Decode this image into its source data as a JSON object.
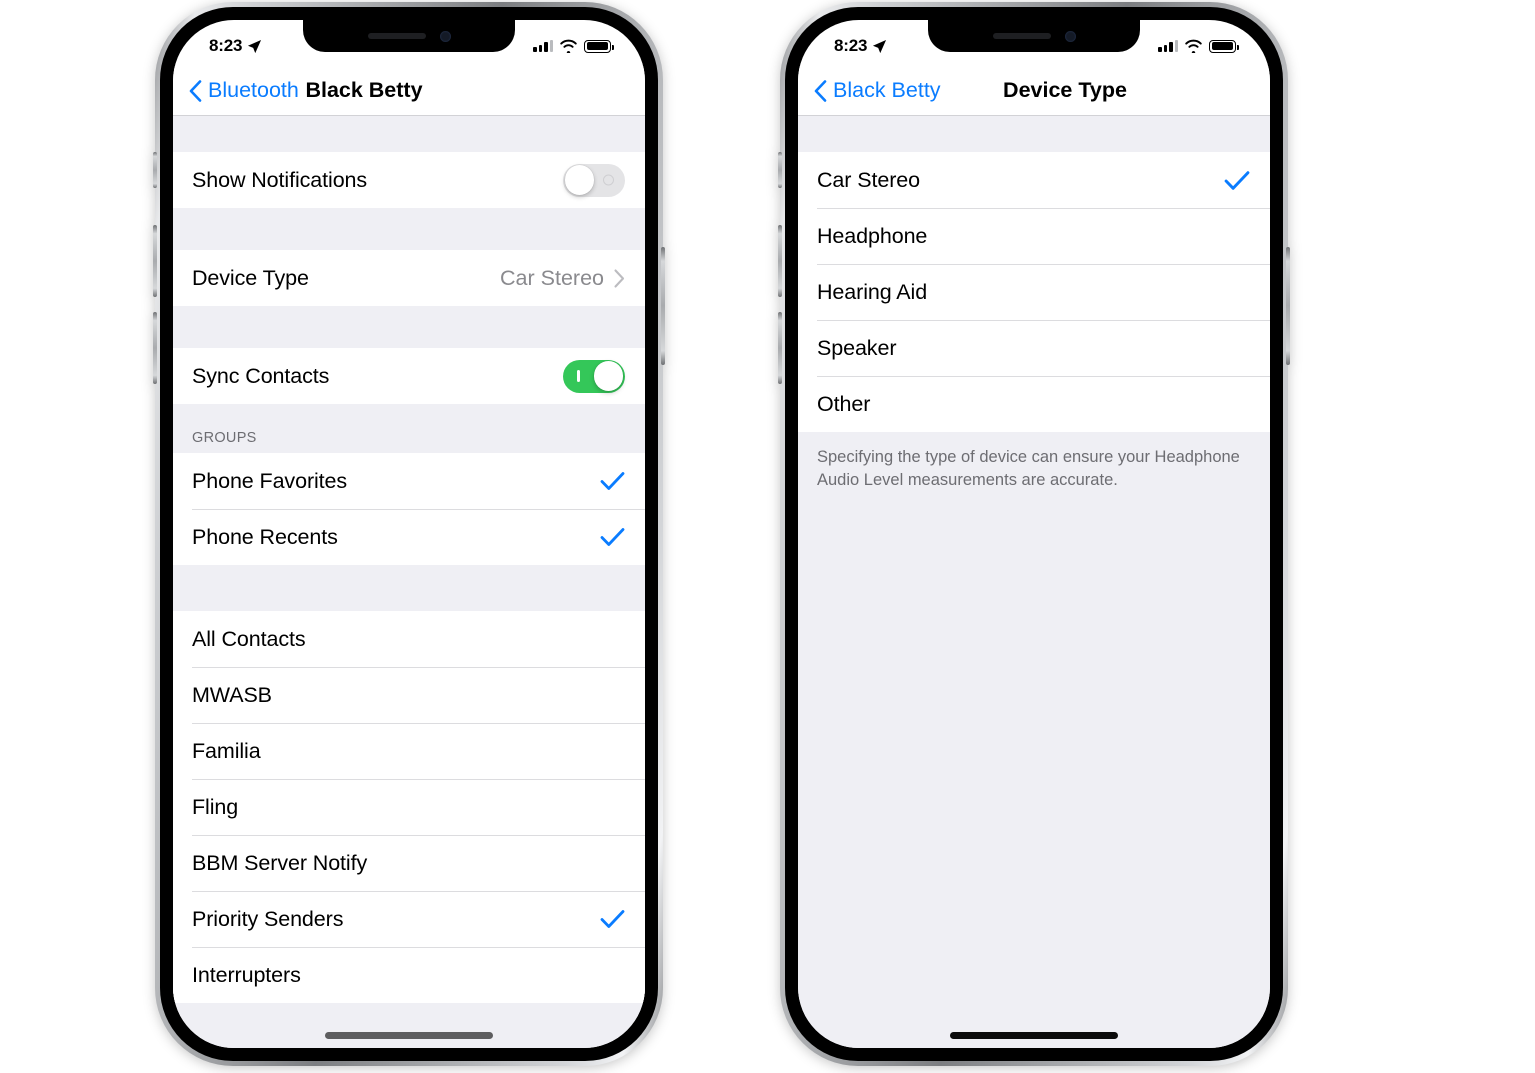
{
  "accent": "#0a7cff",
  "toggle_on_color": "#34c759",
  "phones": [
    {
      "id": "phone-1",
      "status_bar": {
        "time": "8:23",
        "location_icon": "location-arrow-icon",
        "signal_icon": "cellular-signal-icon",
        "wifi_icon": "wifi-icon",
        "battery_icon": "battery-icon"
      },
      "nav": {
        "back_label": "Bluetooth",
        "back_icon": "chevron-left-icon",
        "title": "Black Betty"
      },
      "settings": {
        "show_notifications": {
          "label": "Show Notifications",
          "state": "off"
        },
        "device_type": {
          "label": "Device Type",
          "value": "Car Stereo",
          "disclosure_icon": "chevron-right-icon"
        },
        "sync_contacts": {
          "label": "Sync Contacts",
          "state": "on"
        }
      },
      "groups_header": "GROUPS",
      "groups": [
        {
          "label": "Phone Favorites",
          "checked": true
        },
        {
          "label": "Phone Recents",
          "checked": true
        }
      ],
      "contact_groups": [
        {
          "label": "All Contacts",
          "checked": false
        },
        {
          "label": "MWASB",
          "checked": false
        },
        {
          "label": "Familia",
          "checked": false
        },
        {
          "label": "Fling",
          "checked": false
        },
        {
          "label": "BBM Server Notify",
          "checked": false
        },
        {
          "label": "Priority Senders",
          "checked": true
        },
        {
          "label": "Interrupters",
          "checked": false
        }
      ]
    },
    {
      "id": "phone-2",
      "status_bar": {
        "time": "8:23",
        "location_icon": "location-arrow-icon",
        "signal_icon": "cellular-signal-icon",
        "wifi_icon": "wifi-icon",
        "battery_icon": "battery-icon"
      },
      "nav": {
        "back_label": "Black Betty",
        "back_icon": "chevron-left-icon",
        "title": "Device Type"
      },
      "options": [
        {
          "label": "Car Stereo",
          "checked": true
        },
        {
          "label": "Headphone",
          "checked": false
        },
        {
          "label": "Hearing Aid",
          "checked": false
        },
        {
          "label": "Speaker",
          "checked": false
        },
        {
          "label": "Other",
          "checked": false
        }
      ],
      "footer_note": "Specifying the type of device can ensure your Headphone Audio Level measurements are accurate."
    }
  ]
}
